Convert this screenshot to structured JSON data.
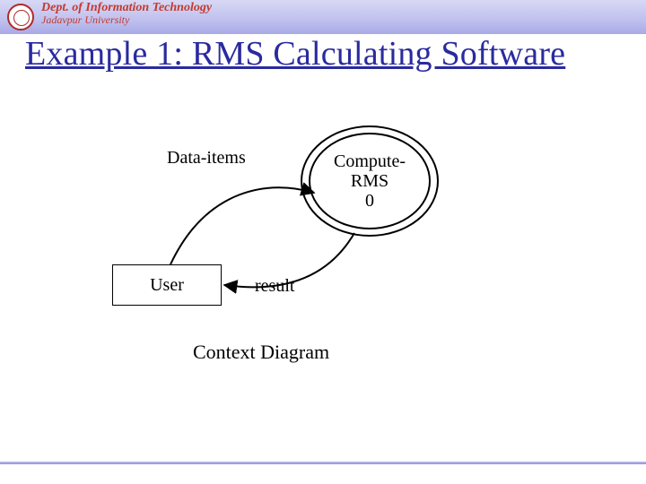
{
  "header": {
    "dept": "Dept. of Information Technology",
    "university": "Jadavpur University"
  },
  "title": "Example 1: RMS Calculating Software",
  "diagram": {
    "flow_in_label": "Data-items",
    "process": {
      "line1": "Compute-",
      "line2": "RMS",
      "line3": "0"
    },
    "external_entity": "User",
    "flow_out_label": "result",
    "caption": "Context Diagram"
  }
}
